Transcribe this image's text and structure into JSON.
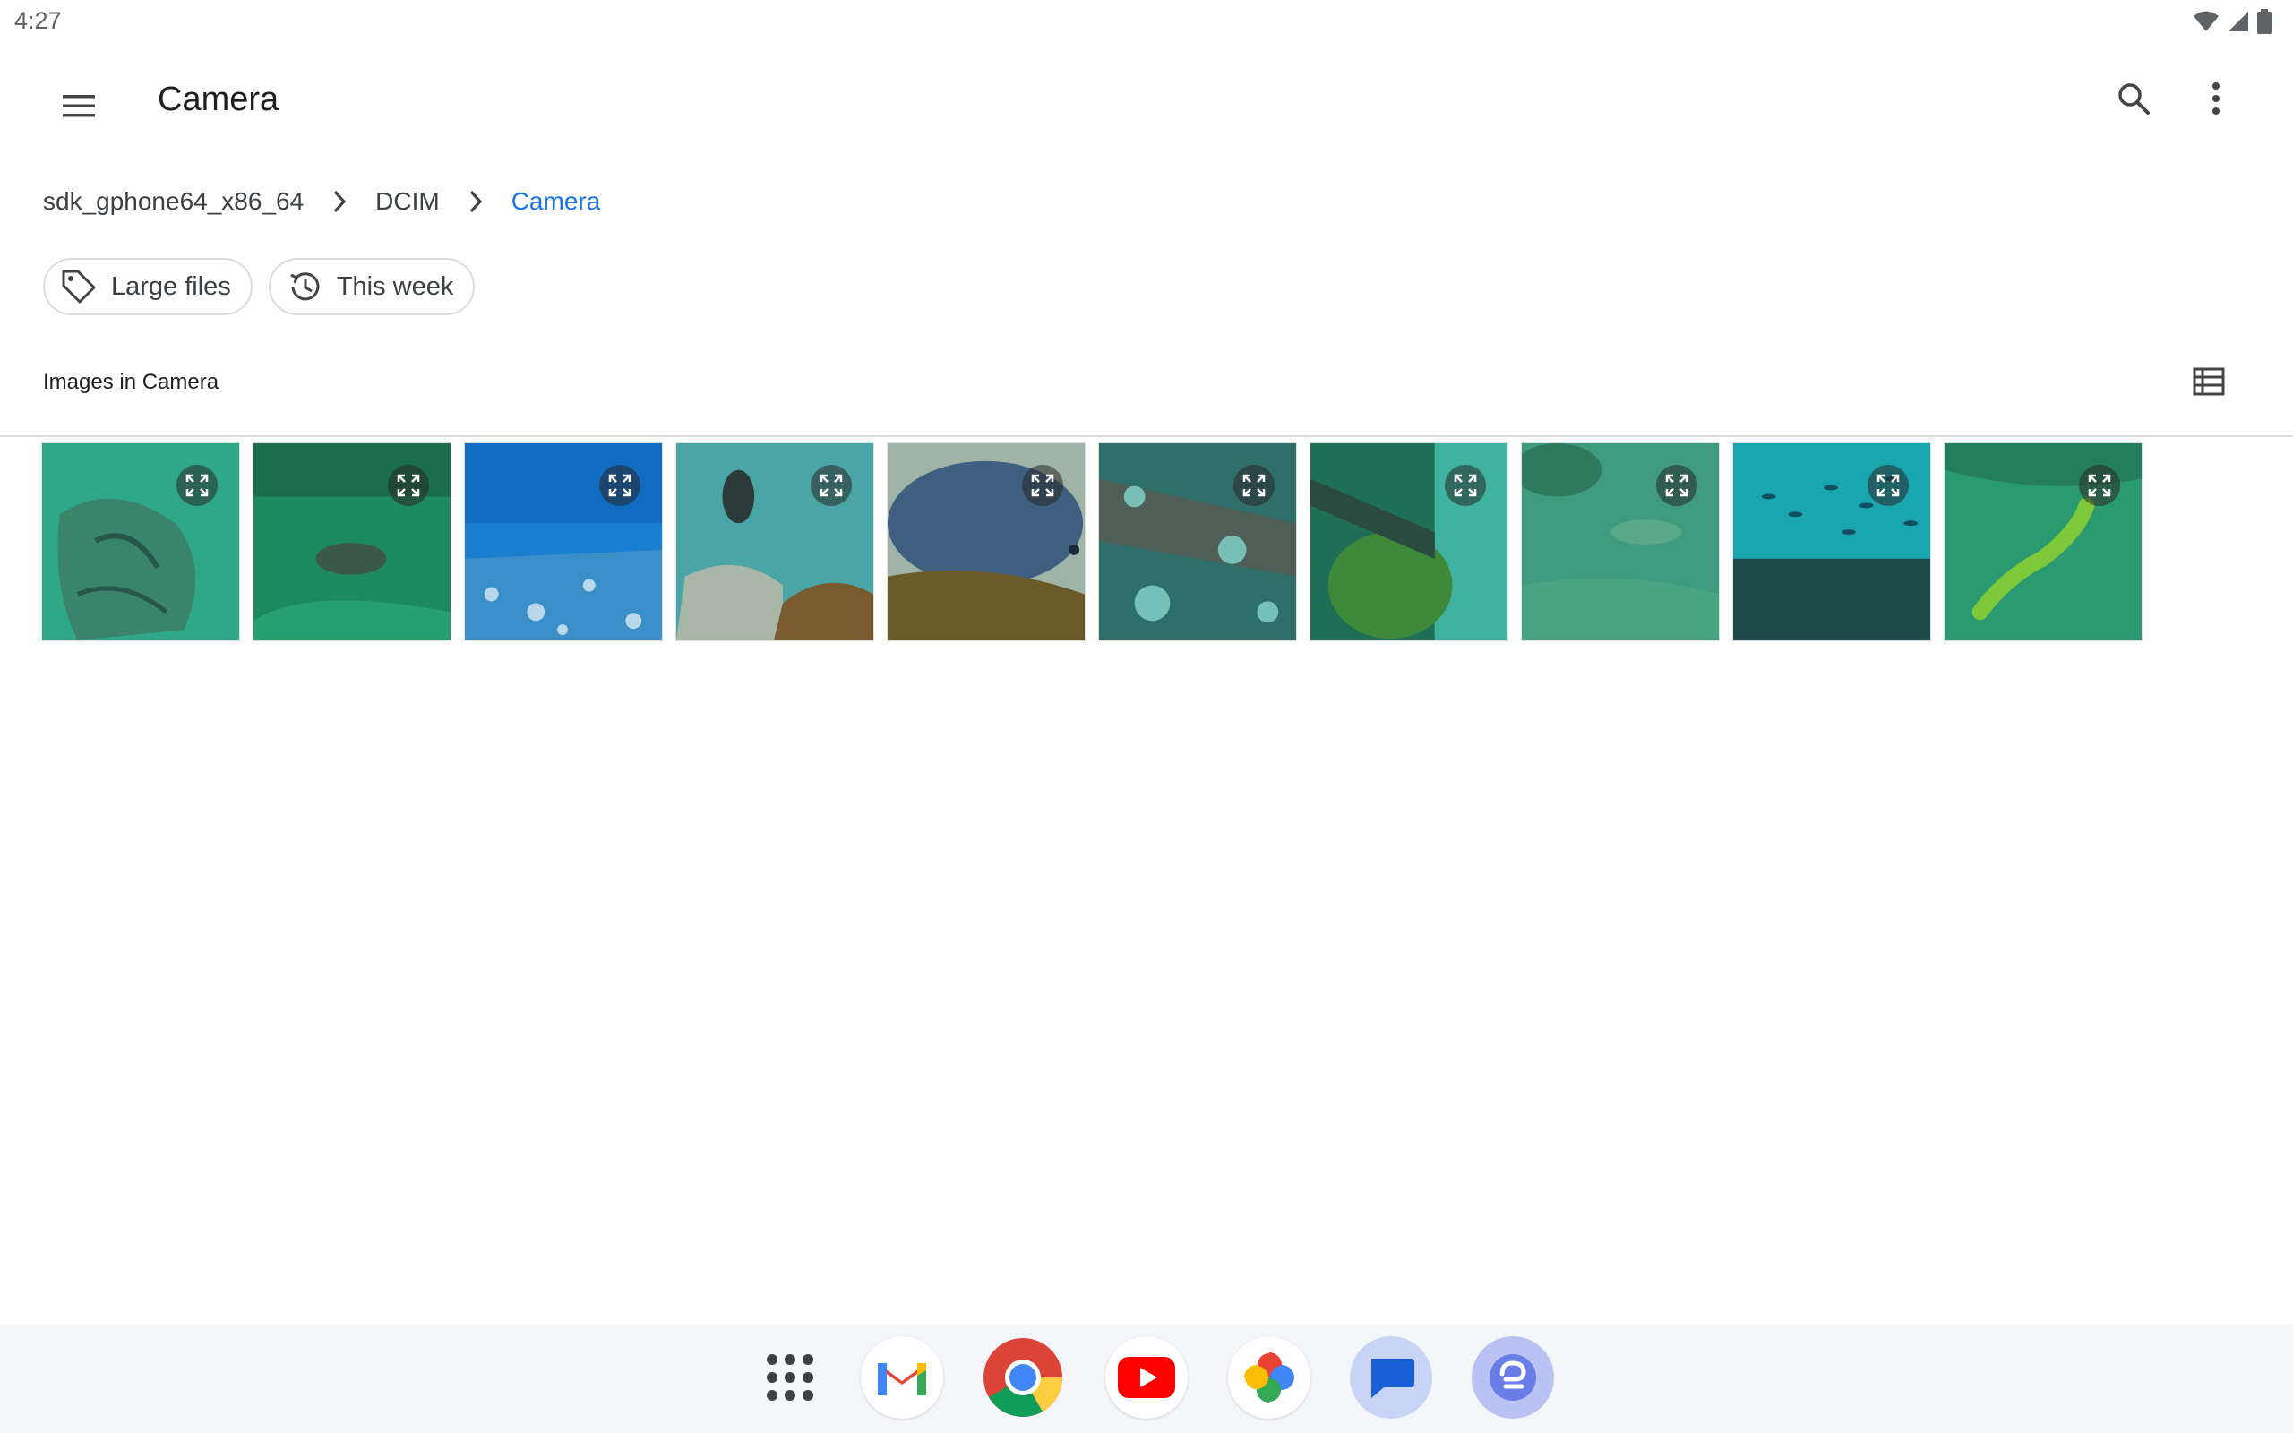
{
  "status_bar": {
    "time": "4:27",
    "icons": [
      "wifi-icon",
      "signal-icon",
      "battery-icon"
    ]
  },
  "app_bar": {
    "title": "Camera",
    "icons": [
      "menu-icon",
      "search-icon",
      "more-vert-icon"
    ]
  },
  "breadcrumb": [
    {
      "label": "sdk_gphone64_x86_64"
    },
    {
      "label": "DCIM"
    },
    {
      "label": "Camera",
      "active": true
    }
  ],
  "chips": [
    {
      "label": "Large files",
      "icon": "tag-icon"
    },
    {
      "label": "This week",
      "icon": "history-icon"
    }
  ],
  "section": {
    "title": "Images in Camera",
    "view_toggle_icon": "list-view-icon"
  },
  "images": [
    {
      "scene": "seafloor-cloth",
      "icon": "expand-icon"
    },
    {
      "scene": "seagrass-fish",
      "icon": "expand-icon"
    },
    {
      "scene": "blue-reef",
      "icon": "expand-icon"
    },
    {
      "scene": "diver",
      "icon": "expand-icon"
    },
    {
      "scene": "blue-groper",
      "icon": "expand-icon"
    },
    {
      "scene": "wreck",
      "icon": "expand-icon"
    },
    {
      "scene": "coral-wall",
      "icon": "expand-icon"
    },
    {
      "scene": "sandy-bottom",
      "icon": "expand-icon"
    },
    {
      "scene": "fish-school",
      "icon": "expand-icon"
    },
    {
      "scene": "green-lizardfish",
      "icon": "expand-icon"
    }
  ],
  "dock": [
    {
      "name": "app-drawer-icon"
    },
    {
      "name": "gmail-icon"
    },
    {
      "name": "chrome-icon"
    },
    {
      "name": "youtube-icon"
    },
    {
      "name": "photos-icon"
    },
    {
      "name": "messages-icon"
    },
    {
      "name": "assistant-app-icon"
    }
  ],
  "colors": {
    "accent": "#1a73e8",
    "text_primary": "#1f1f1f",
    "text_secondary": "#3c4043",
    "chip_border": "#dadce0",
    "dock_bg": "#f5f6fa"
  }
}
